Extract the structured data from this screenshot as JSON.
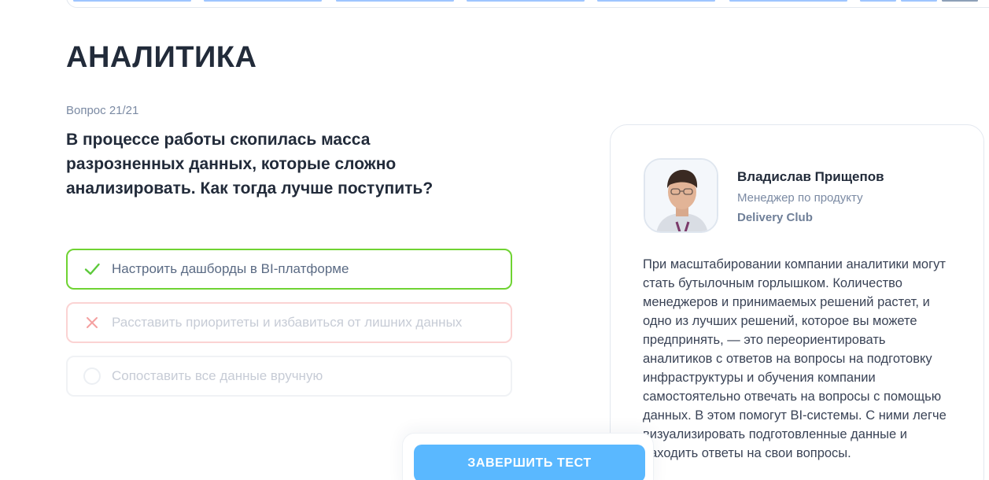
{
  "page": {
    "title": "АНАЛИТИКА"
  },
  "question": {
    "counter": "Вопрос 21/21",
    "text": "В процессе работы скопилась масса разрозненных данных, которые сложно анализировать. Как тогда лучше поступить?"
  },
  "options": [
    {
      "label": "Настроить дашборды в BI-платформе",
      "state": "correct",
      "icon": "check-icon"
    },
    {
      "label": "Расставить приоритеты и избавиться от лишних данных",
      "state": "wrong",
      "icon": "cross-icon"
    },
    {
      "label": "Сопоставить все данные вручную",
      "state": "neutral",
      "icon": "radio-circle-icon"
    }
  ],
  "expert": {
    "name": "Владислав Прищепов",
    "role": "Менеджер по продукту",
    "company": "Delivery Club",
    "comment": "При масштабировании компании аналитики могут стать бутылочным горлышком. Количество менеджеров и принимаемых решений растет, и одно из лучших решений, которое вы можете предпринять, — это переориентировать аналитиков с ответов на вопросы на подготовку инфраструктуры и обучения компании самостоятельно отвечать на вопросы с помощью данных. В этом помогут BI-системы. С ними легче визуализировать подготовленные данные и находить ответы на свои вопросы."
  },
  "actions": {
    "finish_label": "ЗАВЕРШИТЬ ТЕСТ"
  },
  "colors": {
    "accent": "#5ab8ff",
    "correct": "#6fd332",
    "wrong": "#fbd3d3",
    "text": "#222b3a",
    "muted": "#7b8aa3"
  }
}
